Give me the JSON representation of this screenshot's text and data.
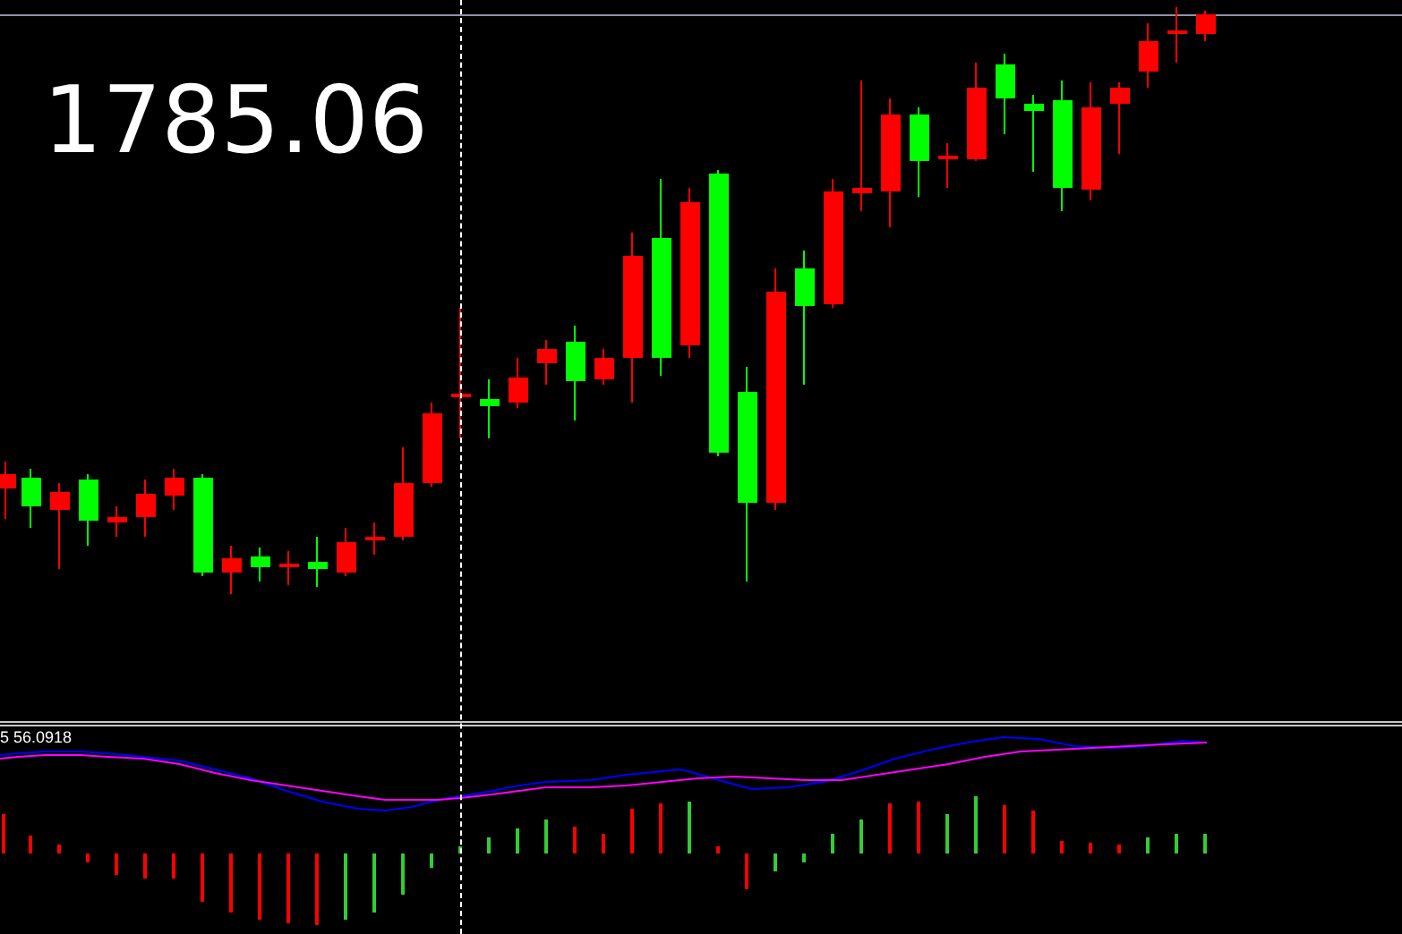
{
  "price_label": "1785.06",
  "indicator": {
    "label": "5 56.0918"
  }
}
